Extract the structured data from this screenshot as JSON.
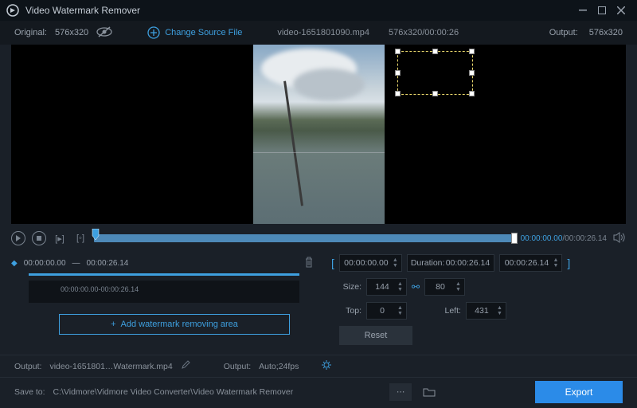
{
  "titlebar": {
    "title": "Video Watermark Remover"
  },
  "infobar": {
    "original_label": "Original:",
    "original_dim": "576x320",
    "change_source": "Change Source File",
    "filename": "video-1651801090.mp4",
    "fileinfo": "576x320/00:00:26",
    "output_label": "Output:",
    "output_dim": "576x320"
  },
  "timeinfo": {
    "current": "00:00:00.00",
    "total": "/00:00:26.14"
  },
  "segment": {
    "start": "00:00:00.00",
    "dash": "—",
    "end": "00:00:26.14",
    "range": "00:00:00.00-00:00:26.14"
  },
  "addarea_label": "Add watermark removing area",
  "range": {
    "start": "00:00:00.00",
    "duration_label": "Duration:",
    "duration": "00:00:26.14",
    "end": "00:00:26.14"
  },
  "size": {
    "label": "Size:",
    "w": "144",
    "h": "80"
  },
  "pos": {
    "top_label": "Top:",
    "top": "0",
    "left_label": "Left:",
    "left": "431"
  },
  "reset": "Reset",
  "footer1": {
    "output_label": "Output:",
    "output_file": "video-1651801…Watermark.mp4",
    "output2_label": "Output:",
    "output2_val": "Auto;24fps"
  },
  "footer2": {
    "saveto_label": "Save to:",
    "path": "C:\\Vidmore\\Vidmore Video Converter\\Video Watermark Remover",
    "export": "Export"
  }
}
